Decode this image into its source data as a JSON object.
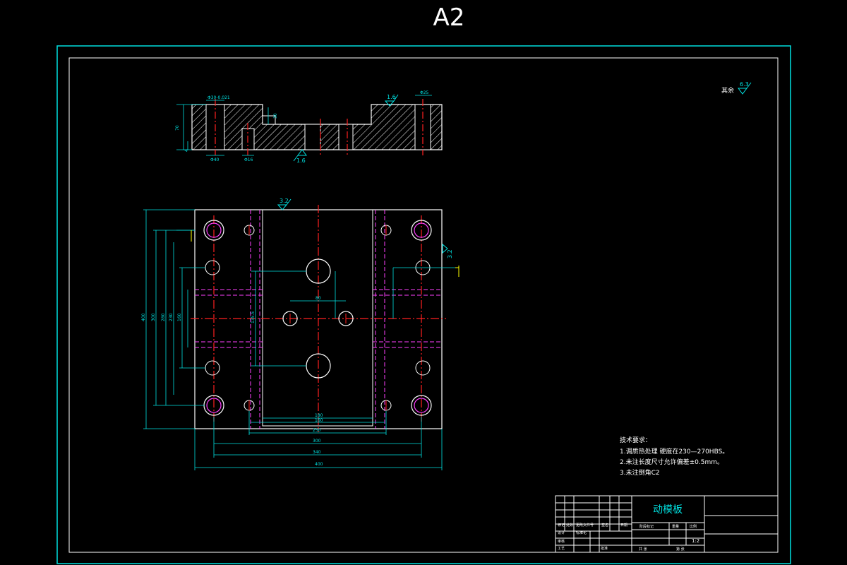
{
  "sheet": {
    "size_label": "A2",
    "title": "动模板",
    "scale": "1:2"
  },
  "roughness": {
    "default_note": "其余",
    "default_value": "6.3",
    "top_face": "1.6",
    "bottom_face": "1.6",
    "plan_top": "3.2",
    "plan_right": "3.2"
  },
  "technical_requirements": {
    "heading": "技术要求：",
    "items": [
      "1.调质热处理 硬度在230—270HBS。",
      "2.未注长度尺寸允许偏差±0.5mm。",
      "3.未注倒角C2"
    ]
  },
  "section_view": {
    "dims": {
      "left_bore": "Φ30-0.021",
      "right_top": "Φ25",
      "height": "70",
      "step": "30",
      "bottom_left": "Φ40",
      "bottom_mid": "Φ16",
      "small": "4"
    }
  },
  "plan_view": {
    "dims": {
      "overall_width": "400",
      "hole_span_340": "340",
      "hole_span_300": "300",
      "hole_span_250": "250",
      "pocket_width": "180",
      "pocket_inner": "160",
      "sprue_span": "80",
      "v_overall": "400",
      "v_300": "300",
      "v_280": "280",
      "v_230": "230",
      "v_160": "160",
      "v_1355": "135.5"
    }
  },
  "title_block": {
    "rows": [
      [
        "标记",
        "处数",
        "分区",
        "更改文件号",
        "签名",
        "日期"
      ],
      [
        "设计",
        "",
        "标准化",
        "",
        "",
        ""
      ],
      [
        "审核",
        "",
        "",
        "",
        "",
        ""
      ],
      [
        "工艺",
        "",
        "批准",
        "",
        "",
        ""
      ]
    ],
    "stage_label": "阶段标记",
    "weight_label": "重量",
    "scale_label": "比例",
    "sheets_label": "共 张",
    "sheet_label": "第 张"
  }
}
